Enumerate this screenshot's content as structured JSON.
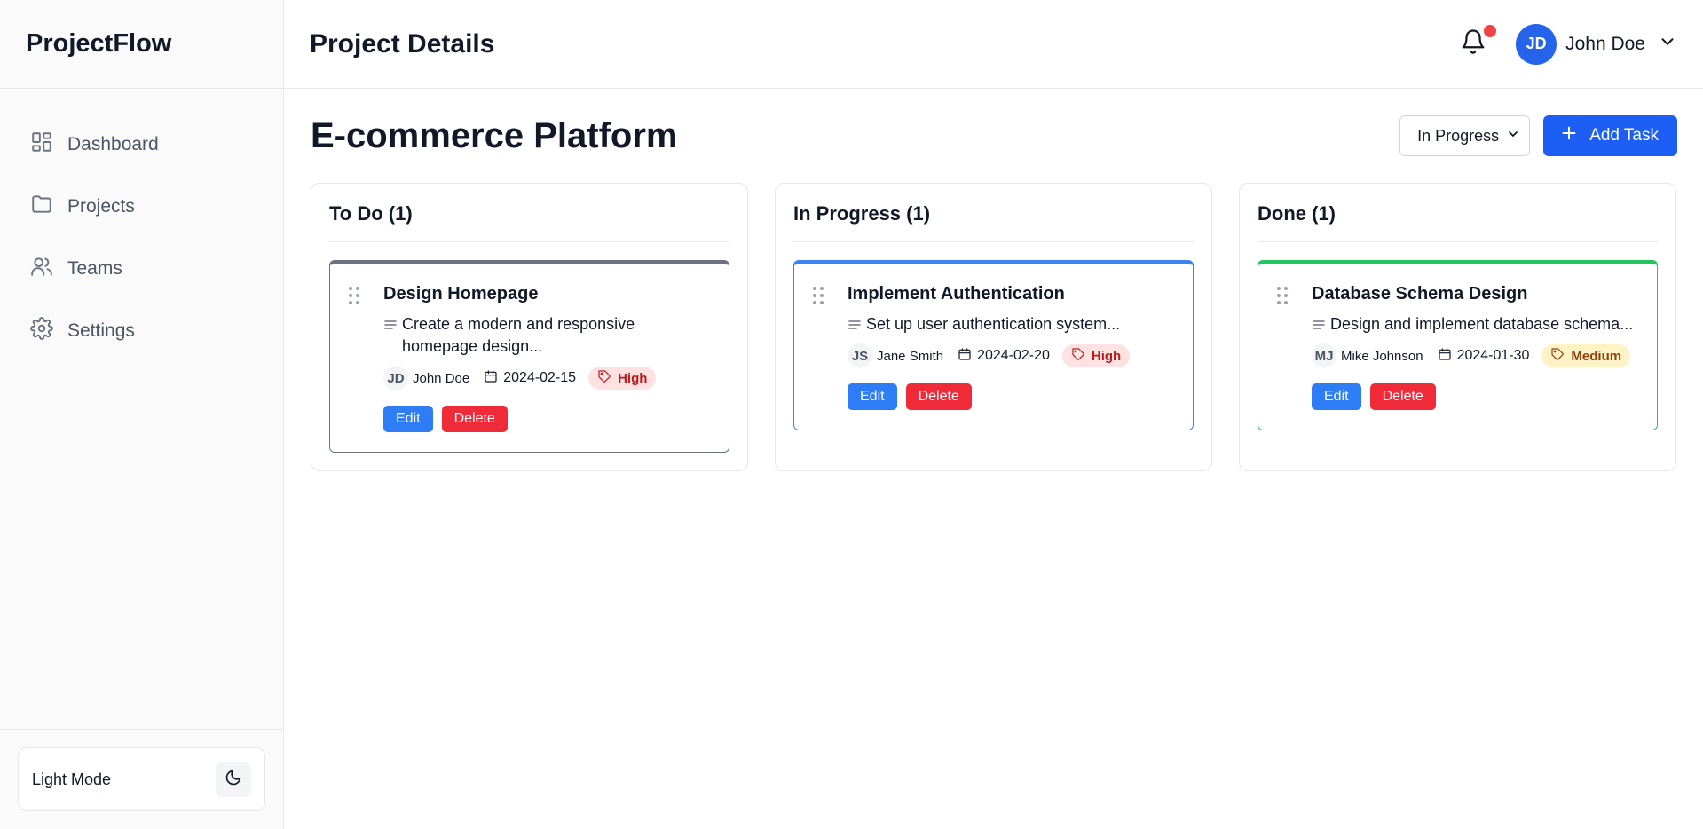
{
  "app": {
    "brand": "ProjectFlow"
  },
  "sidebar": {
    "items": [
      {
        "label": "Dashboard",
        "icon": "dashboard-icon"
      },
      {
        "label": "Projects",
        "icon": "folder-icon"
      },
      {
        "label": "Teams",
        "icon": "users-icon"
      },
      {
        "label": "Settings",
        "icon": "gear-icon"
      }
    ],
    "footer": {
      "mode_label": "Light Mode",
      "toggle_icon": "moon-icon"
    }
  },
  "header": {
    "title": "Project Details",
    "user": {
      "initials": "JD",
      "name": "John Doe"
    },
    "notification_dot": true
  },
  "main": {
    "project_title": "E-commerce Platform",
    "status_select": {
      "value": "In Progress"
    },
    "add_task_label": "Add Task",
    "columns": [
      {
        "title": "To Do (1)",
        "accent": "#6b7280",
        "card": {
          "title": "Design Homepage",
          "description": "Create a modern and responsive homepage design...",
          "assignee_initials": "JD",
          "assignee": "John Doe",
          "due": "2024-02-15",
          "priority": "High",
          "edit_label": "Edit",
          "delete_label": "Delete"
        }
      },
      {
        "title": "In Progress (1)",
        "accent": "#3b82f6",
        "card": {
          "title": "Implement Authentication",
          "description": "Set up user authentication system...",
          "assignee_initials": "JS",
          "assignee": "Jane Smith",
          "due": "2024-02-20",
          "priority": "High",
          "edit_label": "Edit",
          "delete_label": "Delete"
        }
      },
      {
        "title": "Done (1)",
        "accent": "#22c55e",
        "card": {
          "title": "Database Schema Design",
          "description": "Design and implement database schema...",
          "assignee_initials": "MJ",
          "assignee": "Mike Johnson",
          "due": "2024-01-30",
          "priority": "Medium",
          "edit_label": "Edit",
          "delete_label": "Delete"
        }
      }
    ]
  },
  "colors": {
    "primary": "#1d5ff5",
    "danger": "#ef2b3a",
    "high_bg": "#fee2e2",
    "medium_bg": "#fef3c7"
  }
}
